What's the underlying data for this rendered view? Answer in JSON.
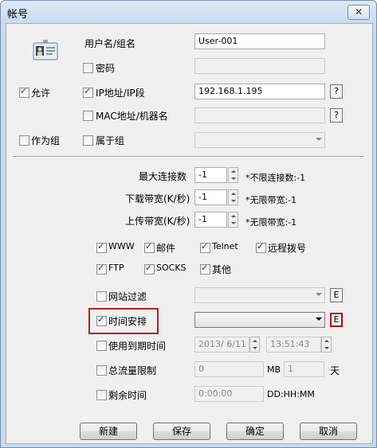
{
  "window": {
    "title": "帐号",
    "close_glyph": "✕"
  },
  "account": {
    "username_label": "用户名/组名",
    "username_value": "User-001",
    "password_label": "密码",
    "password_checked": false,
    "ip_label": "IP地址/IP段",
    "ip_checked": true,
    "ip_value": "192.168.1.195",
    "mac_label": "MAC地址/机器名",
    "mac_checked": false,
    "group_label": "属于组",
    "group_checked": false,
    "allow_label": "允许",
    "allow_checked": true,
    "as_group_label": "作为组",
    "as_group_checked": false,
    "help_glyph": "?"
  },
  "limits": {
    "max_conn_label": "最大连接数",
    "max_conn_value": "-1",
    "max_conn_hint": "不限连接数:-1",
    "download_label": "下载带宽(K/秒)",
    "download_value": "-1",
    "download_hint": "无限带宽:-1",
    "upload_label": "上传带宽(K/秒)",
    "upload_value": "-1",
    "upload_hint": "无限带宽:-1",
    "hint_prefix": "*"
  },
  "services": [
    {
      "label": "WWW",
      "checked": true
    },
    {
      "label": "邮件",
      "checked": true
    },
    {
      "label": "Telnet",
      "checked": true
    },
    {
      "label": "远程拨号",
      "checked": true
    },
    {
      "label": "FTP",
      "checked": true
    },
    {
      "label": "SOCKS",
      "checked": true
    },
    {
      "label": "其他",
      "checked": true
    }
  ],
  "policies": {
    "web_filter_label": "网站过滤",
    "web_filter_checked": false,
    "schedule_label": "时间安排",
    "schedule_checked": true,
    "expiry_label": "使用到期时间",
    "expiry_checked": false,
    "expiry_date": "2013/  6/11",
    "expiry_time": "13:51:43",
    "traffic_label": "总流量限制",
    "traffic_checked": false,
    "traffic_value": "0",
    "traffic_unit": "MB",
    "traffic_days": "1",
    "traffic_days_unit": "天",
    "remain_label": "剩余时间",
    "remain_checked": false,
    "remain_value": "0:00:00",
    "remain_format": "DD:HH:MM",
    "edit_glyph": "E"
  },
  "buttons": {
    "new": "新建",
    "save": "保存",
    "ok": "确定",
    "cancel": "取消"
  },
  "colors": {
    "highlight_border": "#b42020"
  }
}
